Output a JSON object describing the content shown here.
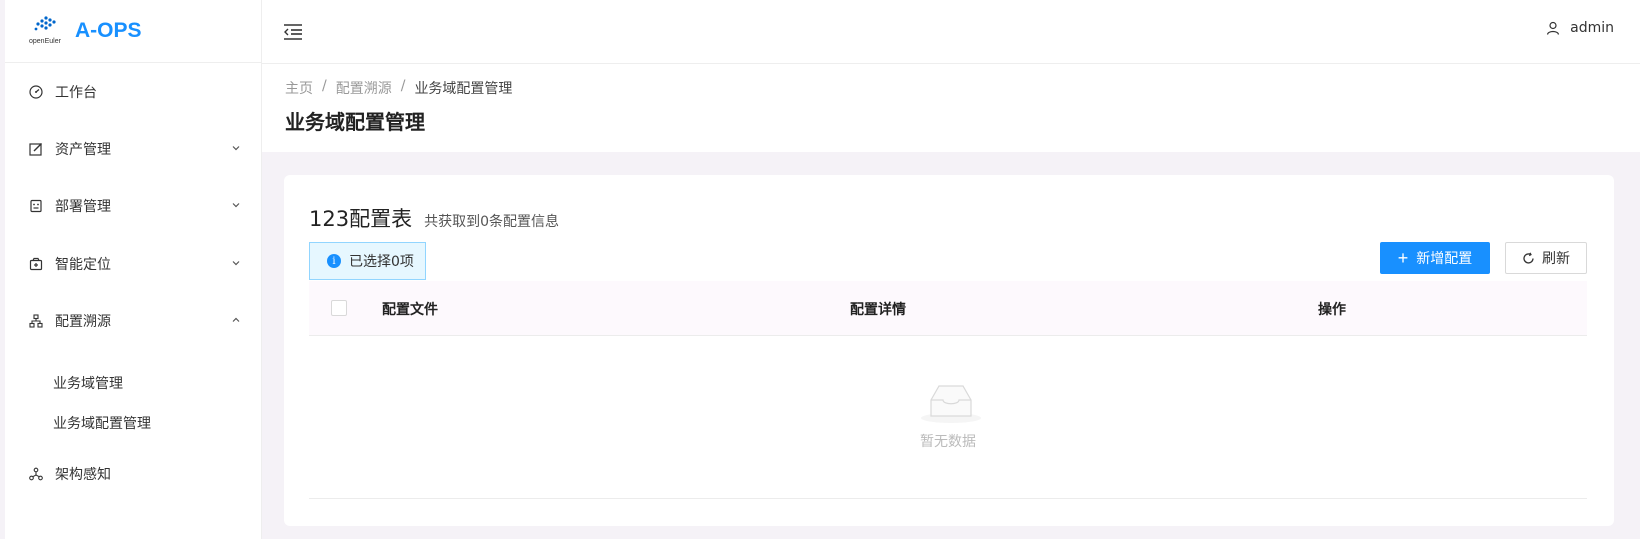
{
  "app": {
    "logo_sub": "openEuler",
    "title": "A-OPS"
  },
  "sidebar": {
    "items": [
      {
        "label": "工作台",
        "icon": "dashboard-icon"
      },
      {
        "label": "资产管理",
        "icon": "edit-square-icon",
        "expanded": false
      },
      {
        "label": "部署管理",
        "icon": "robot-icon",
        "expanded": false
      },
      {
        "label": "智能定位",
        "icon": "medicine-box-icon",
        "expanded": false
      },
      {
        "label": "配置溯源",
        "icon": "cluster-icon",
        "expanded": true
      },
      {
        "label": "架构感知",
        "icon": "deployment-unit-icon"
      }
    ],
    "subitems": [
      {
        "label": "业务域管理"
      },
      {
        "label": "业务域配置管理"
      }
    ]
  },
  "header": {
    "user": "admin"
  },
  "breadcrumb": [
    "主页",
    "配置溯源",
    "业务域配置管理"
  ],
  "page_title": "业务域配置管理",
  "card": {
    "title": "123配置表",
    "subtitle": "共获取到0条配置信息",
    "selected_text": "已选择0项",
    "add_label": "新增配置",
    "refresh_label": "刷新",
    "columns": [
      "配置文件",
      "配置详情",
      "操作"
    ],
    "empty_text": "暂无数据"
  },
  "colors": {
    "primary": "#1890ff",
    "alert_bg": "#e6f7ff",
    "alert_border": "#91d5ff"
  }
}
